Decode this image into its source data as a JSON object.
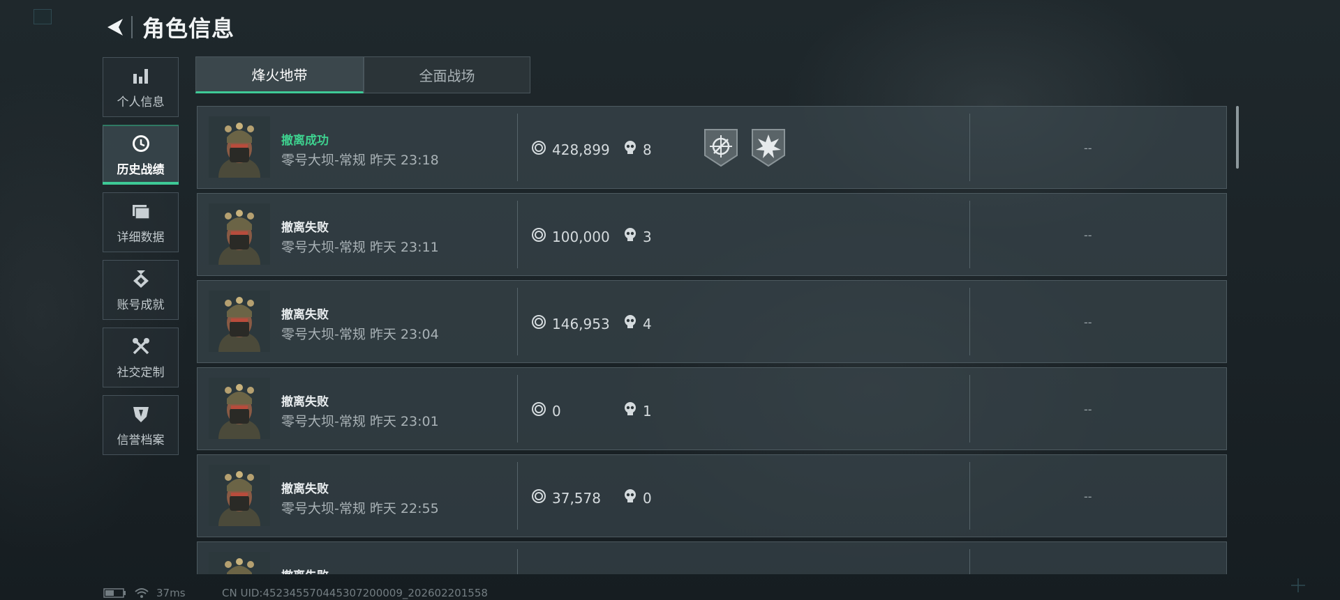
{
  "header": {
    "title": "角色信息"
  },
  "sidebar": {
    "items": [
      {
        "label": "个人信息",
        "icon": "bar-chart-icon",
        "active": false
      },
      {
        "label": "历史战绩",
        "icon": "clock-icon",
        "active": true
      },
      {
        "label": "详细数据",
        "icon": "folder-icon",
        "active": false
      },
      {
        "label": "账号成就",
        "icon": "medal-icon",
        "active": false
      },
      {
        "label": "社交定制",
        "icon": "tools-icon",
        "active": false
      },
      {
        "label": "信誉档案",
        "icon": "shield-icon",
        "active": false
      }
    ]
  },
  "tabs": [
    {
      "label": "烽火地带",
      "active": true
    },
    {
      "label": "全面战场",
      "active": false
    }
  ],
  "matches": [
    {
      "result": "撤离成功",
      "success": true,
      "map_time": "零号大坝-常规 昨天 23:18",
      "value": "428,899",
      "kills": "8",
      "badges": [
        "crosshair-medal-icon",
        "explosion-medal-icon"
      ],
      "extra": "--"
    },
    {
      "result": "撤离失败",
      "success": false,
      "map_time": "零号大坝-常规 昨天 23:11",
      "value": "100,000",
      "kills": "3",
      "badges": [],
      "extra": "--"
    },
    {
      "result": "撤离失败",
      "success": false,
      "map_time": "零号大坝-常规 昨天 23:04",
      "value": "146,953",
      "kills": "4",
      "badges": [],
      "extra": "--"
    },
    {
      "result": "撤离失败",
      "success": false,
      "map_time": "零号大坝-常规 昨天 23:01",
      "value": "0",
      "kills": "1",
      "badges": [],
      "extra": "--"
    },
    {
      "result": "撤离失败",
      "success": false,
      "map_time": "零号大坝-常规 昨天 22:55",
      "value": "37,578",
      "kills": "0",
      "badges": [],
      "extra": "--"
    },
    {
      "result": "撤离失败",
      "success": false,
      "map_time": "",
      "value": "",
      "kills": "",
      "badges": [],
      "extra": ""
    }
  ],
  "status": {
    "ping": "37ms",
    "uid": "CN UID:452345570445307200009_202602201558"
  },
  "colors": {
    "accent": "#3ec996",
    "success": "#3ed18f",
    "panel": "#3e4a50"
  }
}
